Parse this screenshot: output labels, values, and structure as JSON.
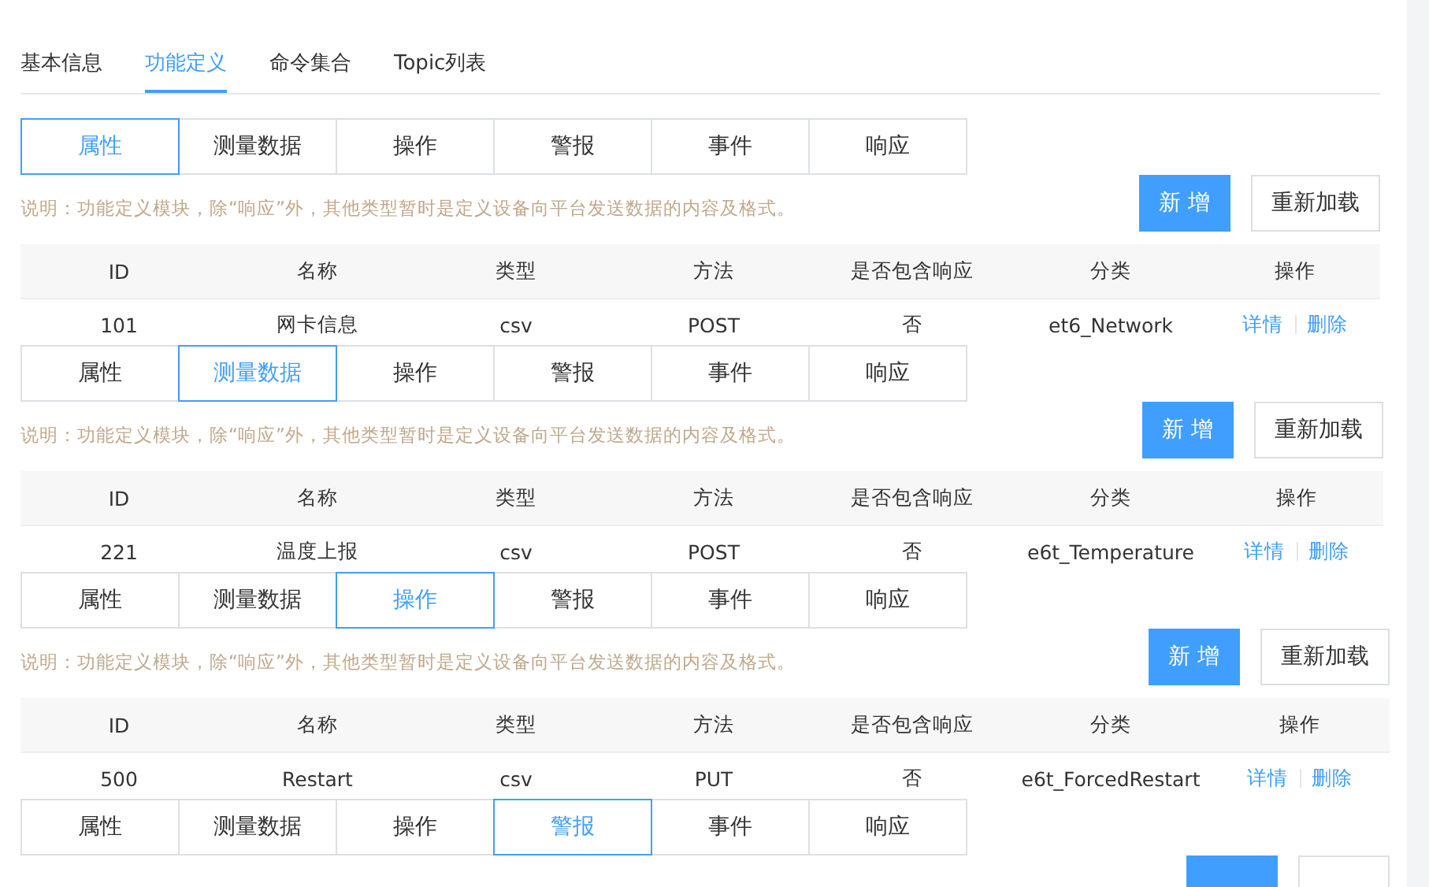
{
  "tabs": [
    {
      "label": "基本信息",
      "selected": false
    },
    {
      "label": "功能定义",
      "selected": true
    },
    {
      "label": "命令集合",
      "selected": false
    },
    {
      "label": "Topic列表",
      "selected": false
    }
  ],
  "sections": [
    {
      "types": [
        {
          "label": "属性",
          "selected": true
        },
        {
          "label": "测量数据",
          "selected": false
        },
        {
          "label": "操作",
          "selected": false
        },
        {
          "label": "警报",
          "selected": false
        },
        {
          "label": "事件",
          "selected": false
        },
        {
          "label": "响应",
          "selected": false
        }
      ],
      "note": "说明：功能定义模块，除“响应”外，其他类型暂时是定义设备向平台发送数据的内容及格式。",
      "buttons": [
        {
          "kind": "primary",
          "label": "新 增"
        },
        {
          "kind": "default",
          "label": "重新加载"
        }
      ],
      "columns": [
        "ID",
        "名称",
        "类型",
        "方法",
        "是否包含响应",
        "分类",
        "操作"
      ],
      "rows": [
        {
          "cells": [
            "101",
            "网卡信息",
            "csv",
            "POST",
            "否",
            "et6_Network"
          ],
          "actions": [
            "详情",
            "删除"
          ]
        }
      ]
    },
    {
      "types": [
        {
          "label": "属性",
          "selected": false
        },
        {
          "label": "测量数据",
          "selected": true
        },
        {
          "label": "操作",
          "selected": false
        },
        {
          "label": "警报",
          "selected": false
        },
        {
          "label": "事件",
          "selected": false
        },
        {
          "label": "响应",
          "selected": false
        }
      ],
      "note": "说明：功能定义模块，除“响应”外，其他类型暂时是定义设备向平台发送数据的内容及格式。",
      "buttons": [
        {
          "kind": "primary",
          "label": "新 增"
        },
        {
          "kind": "default",
          "label": "重新加载"
        }
      ],
      "columns": [
        "ID",
        "名称",
        "类型",
        "方法",
        "是否包含响应",
        "分类",
        "操作"
      ],
      "rows": [
        {
          "cells": [
            "221",
            "温度上报",
            "csv",
            "POST",
            "否",
            "e6t_Temperature"
          ],
          "actions": [
            "详情",
            "删除"
          ]
        }
      ]
    },
    {
      "types": [
        {
          "label": "属性",
          "selected": false
        },
        {
          "label": "测量数据",
          "selected": false
        },
        {
          "label": "操作",
          "selected": true
        },
        {
          "label": "警报",
          "selected": false
        },
        {
          "label": "事件",
          "selected": false
        },
        {
          "label": "响应",
          "selected": false
        }
      ],
      "note": "说明：功能定义模块，除“响应”外，其他类型暂时是定义设备向平台发送数据的内容及格式。",
      "buttons": [
        {
          "kind": "primary",
          "label": "新 增"
        },
        {
          "kind": "default",
          "label": "重新加载"
        }
      ],
      "columns": [
        "ID",
        "名称",
        "类型",
        "方法",
        "是否包含响应",
        "分类",
        "操作"
      ],
      "rows": [
        {
          "cells": [
            "500",
            "Restart",
            "csv",
            "PUT",
            "否",
            "e6t_ForcedRestart"
          ],
          "actions": [
            "详情",
            "删除"
          ]
        }
      ]
    },
    {
      "types": [
        {
          "label": "属性",
          "selected": false
        },
        {
          "label": "测量数据",
          "selected": false
        },
        {
          "label": "操作",
          "selected": false
        },
        {
          "label": "警报",
          "selected": true
        },
        {
          "label": "事件",
          "selected": false
        },
        {
          "label": "响应",
          "selected": false
        }
      ],
      "buttons": [
        {
          "kind": "primary"
        },
        {
          "kind": "default"
        }
      ]
    }
  ]
}
